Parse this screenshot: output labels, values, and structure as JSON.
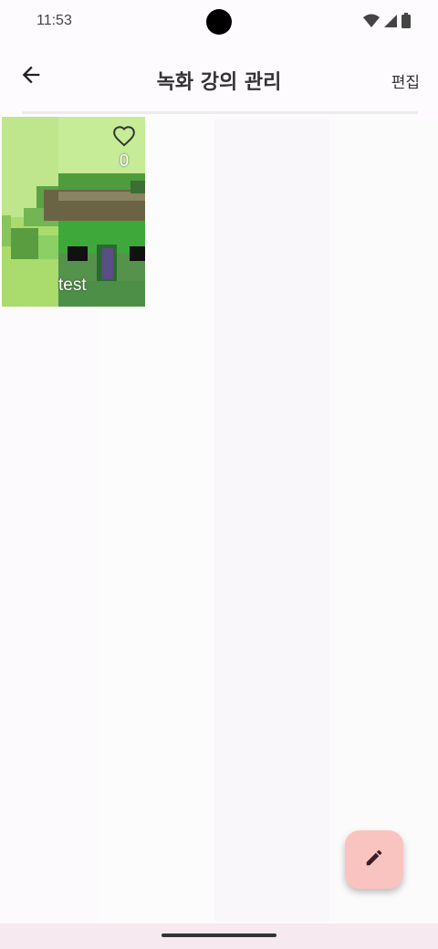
{
  "status_bar": {
    "time": "11:53",
    "icons": [
      "wifi-icon",
      "signal-icon",
      "battery-icon"
    ]
  },
  "app_bar": {
    "back_icon": "arrow-left-icon",
    "title": "녹화 강의 관리",
    "edit_label": "편집"
  },
  "lectures": [
    {
      "title": "test",
      "likes": "0",
      "like_icon": "heart-outline-icon"
    }
  ],
  "fab": {
    "icon": "pencil-icon",
    "color": "#f9c4c0"
  },
  "colors": {
    "background": "#fdfbfd",
    "nav_bar": "#f7e9f0",
    "fab": "#f9c4c0"
  }
}
